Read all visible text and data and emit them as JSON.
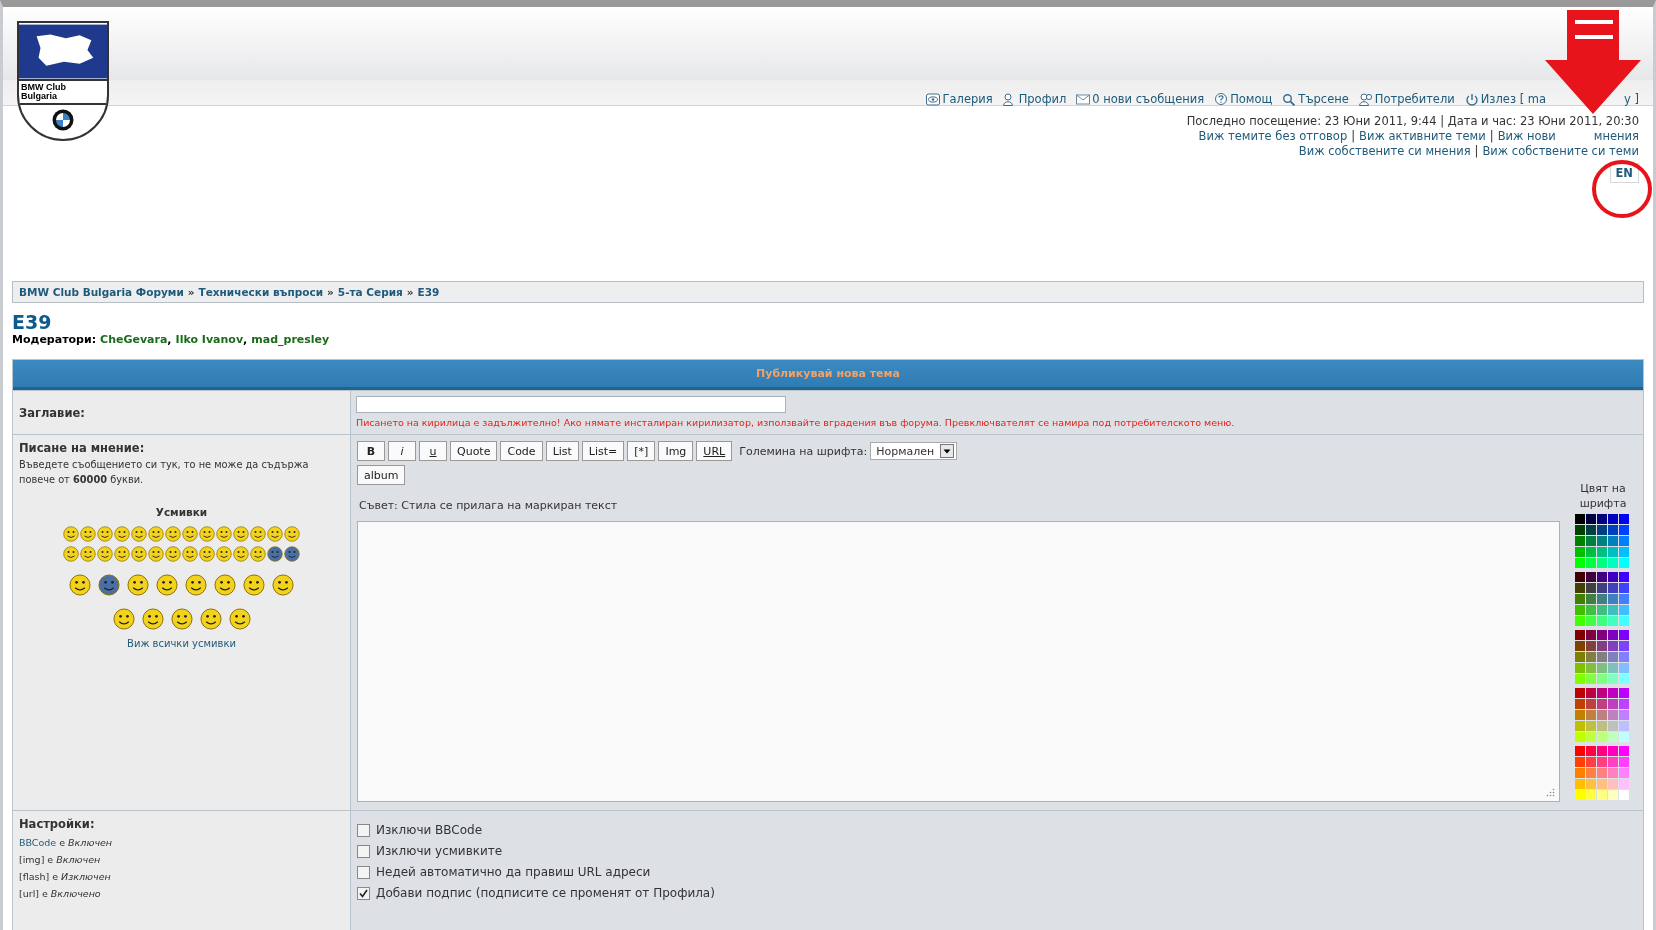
{
  "logo": {
    "line_1": "BMW Club",
    "line_2": "Bulgaria"
  },
  "nav": [
    {
      "kind": "gallery",
      "label": "Галерия"
    },
    {
      "kind": "profile",
      "label": "Профил"
    },
    {
      "kind": "mail",
      "label": "0 нови съобщения"
    },
    {
      "kind": "help",
      "label": "Помощ"
    },
    {
      "kind": "search",
      "label": "Търсене"
    },
    {
      "kind": "users",
      "label": "Потребители"
    },
    {
      "kind": "logout",
      "label": "Излез [ ma",
      "tail": "y ]"
    }
  ],
  "visit_info": "Последно посещение: 23 Юни 2011, 9:44 | Дата и час: 23 Юни 2011, 20:30",
  "link_separator": "|",
  "links_row_1": [
    {
      "label": "Виж темите без отговор"
    },
    {
      "label": "Виж активните теми"
    },
    {
      "label": "Виж нови",
      "tail": "мнения"
    }
  ],
  "links_row_2": [
    {
      "label": "Виж собствените си мнения"
    },
    {
      "label": "Виж собствените си теми"
    }
  ],
  "language_button": "EN",
  "breadcrumb": [
    "BMW Club Bulgaria Форуми",
    "Технически въпроси",
    "5-та Серия",
    "E39"
  ],
  "breadcrumb_separator": "»",
  "forum_title": "E39",
  "moderators_label": "Модератори:",
  "moderator_separator": ",",
  "moderators": [
    "CheGevara",
    "Ilko Ivanov",
    "mad_presley"
  ],
  "form_header": "Публикувай нова тема",
  "subject": {
    "label": "Заглавие:",
    "warning": "Писането на кирилица е задължително! Ако нямате инсталиран кирилизатор, използвайте вградения във форума. Превключвателят се намира под потребителското меню."
  },
  "message": {
    "label": "Писане на мнение:",
    "hint": "Въведете съобщението си тук, то не може да съдържа повече от **60000** букви.",
    "smilies_title": "Усмивки",
    "smilies_link": "Виж всички усмивки",
    "font_color_label": "Цвят на шрифта",
    "tip": "Съвет: Стила се прилага на маркиран текст"
  },
  "toolbar": [
    {
      "label": "B",
      "kind": "bold"
    },
    {
      "label": "i",
      "kind": "italic"
    },
    {
      "label": "u",
      "kind": "underline"
    },
    {
      "label": "Quote",
      "kind": "plain"
    },
    {
      "label": "Code",
      "kind": "plain"
    },
    {
      "label": "List",
      "kind": "plain"
    },
    {
      "label": "List=",
      "kind": "plain"
    },
    {
      "label": "[*]",
      "kind": "plain"
    },
    {
      "label": "Img",
      "kind": "plain"
    },
    {
      "label": "URL",
      "kind": "underline"
    }
  ],
  "font_size": {
    "label": "Големина на шрифта:",
    "value": "Нормален"
  },
  "album_button": "album",
  "options_label": "Настройки:",
  "options_info": [
    {
      "name": "BBCode",
      "link": true,
      "verb": "е",
      "state": "Включен"
    },
    {
      "name": "[img]",
      "link": false,
      "verb": "е",
      "state": "Включен"
    },
    {
      "name": "[flash]",
      "link": false,
      "verb": "е",
      "state": "Изключен"
    },
    {
      "name": "[url]",
      "link": false,
      "verb": "е",
      "state": "Включено"
    }
  ],
  "options": [
    {
      "label": "Изключи BBCode",
      "checked": false
    },
    {
      "label": "Изключи усмивките",
      "checked": false
    },
    {
      "label": "Недей автоматично да правиш URL адреси",
      "checked": false
    },
    {
      "label": "Добави подпис (подписите се променят от Профила)",
      "checked": true
    }
  ]
}
